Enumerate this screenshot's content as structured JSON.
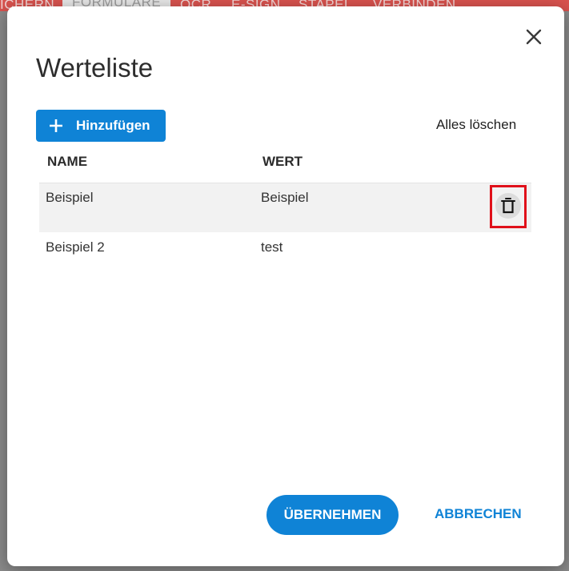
{
  "background": {
    "tabs": [
      "ICHERN",
      "FORMULARE",
      "OCR",
      "E-SIGN",
      "STAPEL",
      "VERBINDEN"
    ]
  },
  "dialog": {
    "title": "Werteliste",
    "add_label": "Hinzufügen",
    "clear_all_label": "Alles löschen",
    "columns": [
      "NAME",
      "WERT"
    ],
    "rows": [
      {
        "name": "Beispiel",
        "value": "Beispiel"
      },
      {
        "name": "Beispiel 2",
        "value": "test"
      }
    ],
    "apply_label": "ÜBERNEHMEN",
    "cancel_label": "ABBRECHEN"
  },
  "icons": {
    "close": "close-icon",
    "add": "plus-icon",
    "delete": "trash-icon"
  },
  "colors": {
    "accent": "#0f83d6",
    "highlight": "#e0101a",
    "topbar": "#d9534f"
  }
}
